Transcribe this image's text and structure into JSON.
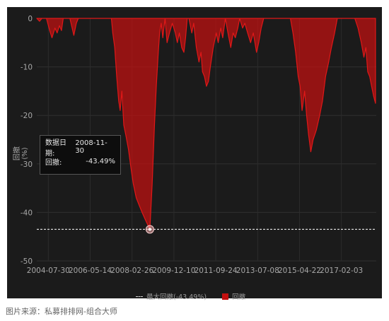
{
  "chart_data": {
    "type": "area",
    "ylabel": "回撤(%)",
    "ylim": [
      -50,
      0
    ],
    "yticks": [
      0,
      -10,
      -20,
      -30,
      -40,
      -50
    ],
    "xlim": [
      "2004-02-01",
      "2018-08-01"
    ],
    "xticks": [
      "2004-07-30",
      "2006-05-14",
      "2008-02-26",
      "2009-12-10",
      "2011-09-24",
      "2013-07-08",
      "2015-04-22",
      "2017-02-03"
    ],
    "grid": true,
    "legend": {
      "placement": "bottom",
      "items": [
        "最大回撤(-43.49%)",
        "回撤"
      ]
    },
    "colors": {
      "drawdown": "#c31010",
      "max_line": "#d8d8d8",
      "background": "#1b1b1b"
    },
    "series": [
      {
        "name": "回撤",
        "points": [
          [
            "2004-02-01",
            0
          ],
          [
            "2004-03-15",
            -0.6
          ],
          [
            "2004-04-20",
            0
          ],
          [
            "2004-07-01",
            0
          ],
          [
            "2004-08-20",
            -2.5
          ],
          [
            "2004-09-25",
            -4
          ],
          [
            "2004-11-10",
            -2
          ],
          [
            "2004-12-15",
            -3
          ],
          [
            "2005-01-20",
            -1.5
          ],
          [
            "2005-02-20",
            -2.5
          ],
          [
            "2005-03-20",
            0
          ],
          [
            "2005-07-01",
            0
          ],
          [
            "2005-09-01",
            -3.5
          ],
          [
            "2005-10-10",
            -1
          ],
          [
            "2005-11-10",
            0
          ],
          [
            "2007-04-10",
            0
          ],
          [
            "2007-05-01",
            -3
          ],
          [
            "2007-06-01",
            -6
          ],
          [
            "2007-07-01",
            -12
          ],
          [
            "2007-08-01",
            -17
          ],
          [
            "2007-08-25",
            -19
          ],
          [
            "2007-09-20",
            -15
          ],
          [
            "2007-10-20",
            -22
          ],
          [
            "2007-11-20",
            -24
          ],
          [
            "2008-01-01",
            -27
          ],
          [
            "2008-02-10",
            -31
          ],
          [
            "2008-03-15",
            -34
          ],
          [
            "2008-05-01",
            -37
          ],
          [
            "2008-06-15",
            -38.5
          ],
          [
            "2008-08-01",
            -40
          ],
          [
            "2008-09-20",
            -41.5
          ],
          [
            "2008-11-30",
            -43.49
          ],
          [
            "2009-01-05",
            -34
          ],
          [
            "2009-02-10",
            -22
          ],
          [
            "2009-03-10",
            -14
          ],
          [
            "2009-04-10",
            -7
          ],
          [
            "2009-05-01",
            -3
          ],
          [
            "2009-05-25",
            -1
          ],
          [
            "2009-06-20",
            -4
          ],
          [
            "2009-07-25",
            0
          ],
          [
            "2009-08-25",
            -5
          ],
          [
            "2009-10-01",
            -3
          ],
          [
            "2009-11-15",
            -1
          ],
          [
            "2010-01-01",
            -3
          ],
          [
            "2010-02-01",
            -5
          ],
          [
            "2010-03-05",
            -3
          ],
          [
            "2010-04-10",
            -6
          ],
          [
            "2010-05-15",
            -7
          ],
          [
            "2010-06-10",
            -4
          ],
          [
            "2010-07-05",
            0
          ],
          [
            "2010-08-01",
            0
          ],
          [
            "2010-09-15",
            -3
          ],
          [
            "2010-10-15",
            -1
          ],
          [
            "2010-11-25",
            -6
          ],
          [
            "2011-01-05",
            -9
          ],
          [
            "2011-02-05",
            -7
          ],
          [
            "2011-03-01",
            -11
          ],
          [
            "2011-04-01",
            -12
          ],
          [
            "2011-05-01",
            -14
          ],
          [
            "2011-06-01",
            -13
          ],
          [
            "2011-07-01",
            -10
          ],
          [
            "2011-08-15",
            -6
          ],
          [
            "2011-10-01",
            -3
          ],
          [
            "2011-11-01",
            -5
          ],
          [
            "2011-12-10",
            -2
          ],
          [
            "2012-01-10",
            -4
          ],
          [
            "2012-02-20",
            0
          ],
          [
            "2012-04-01",
            -3
          ],
          [
            "2012-05-15",
            -6
          ],
          [
            "2012-06-20",
            -3
          ],
          [
            "2012-07-25",
            -4
          ],
          [
            "2012-09-01",
            -2
          ],
          [
            "2012-10-01",
            0
          ],
          [
            "2012-11-15",
            -2
          ],
          [
            "2012-12-20",
            -1
          ],
          [
            "2013-02-01",
            -3
          ],
          [
            "2013-03-20",
            -5
          ],
          [
            "2013-05-01",
            -3
          ],
          [
            "2013-06-20",
            -7
          ],
          [
            "2013-07-25",
            -5
          ],
          [
            "2013-09-01",
            -2
          ],
          [
            "2013-10-10",
            0
          ],
          [
            "2014-12-01",
            0
          ],
          [
            "2015-01-10",
            -3
          ],
          [
            "2015-02-20",
            -7
          ],
          [
            "2015-04-01",
            -12
          ],
          [
            "2015-05-01",
            -14
          ],
          [
            "2015-06-01",
            -19
          ],
          [
            "2015-07-10",
            -15
          ],
          [
            "2015-08-10",
            -20
          ],
          [
            "2015-09-10",
            -24
          ],
          [
            "2015-10-15",
            -27.5
          ],
          [
            "2015-11-20",
            -25
          ],
          [
            "2016-01-10",
            -23
          ],
          [
            "2016-03-01",
            -20
          ],
          [
            "2016-04-15",
            -17
          ],
          [
            "2016-06-01",
            -12
          ],
          [
            "2016-07-20",
            -9
          ],
          [
            "2016-09-01",
            -6
          ],
          [
            "2016-10-20",
            -3
          ],
          [
            "2016-12-01",
            0
          ],
          [
            "2017-09-01",
            0
          ],
          [
            "2017-10-20",
            -2
          ],
          [
            "2017-12-10",
            -5
          ],
          [
            "2018-01-20",
            -8
          ],
          [
            "2018-02-20",
            -6
          ],
          [
            "2018-03-20",
            -11
          ],
          [
            "2018-04-20",
            -12
          ],
          [
            "2018-05-20",
            -14
          ],
          [
            "2018-06-20",
            -16
          ],
          [
            "2018-07-20",
            -17.5
          ]
        ]
      }
    ],
    "max_drawdown": {
      "label": "最大回撤(-43.49%)",
      "value": -43.49,
      "date": "2008-11-30"
    }
  },
  "tooltip": {
    "date_label": "数据日期:",
    "date_value": "2008-11-30",
    "dd_label": "回撤:",
    "dd_value": "-43.49%"
  },
  "caption": "图片来源：私募排排网-组合大师"
}
